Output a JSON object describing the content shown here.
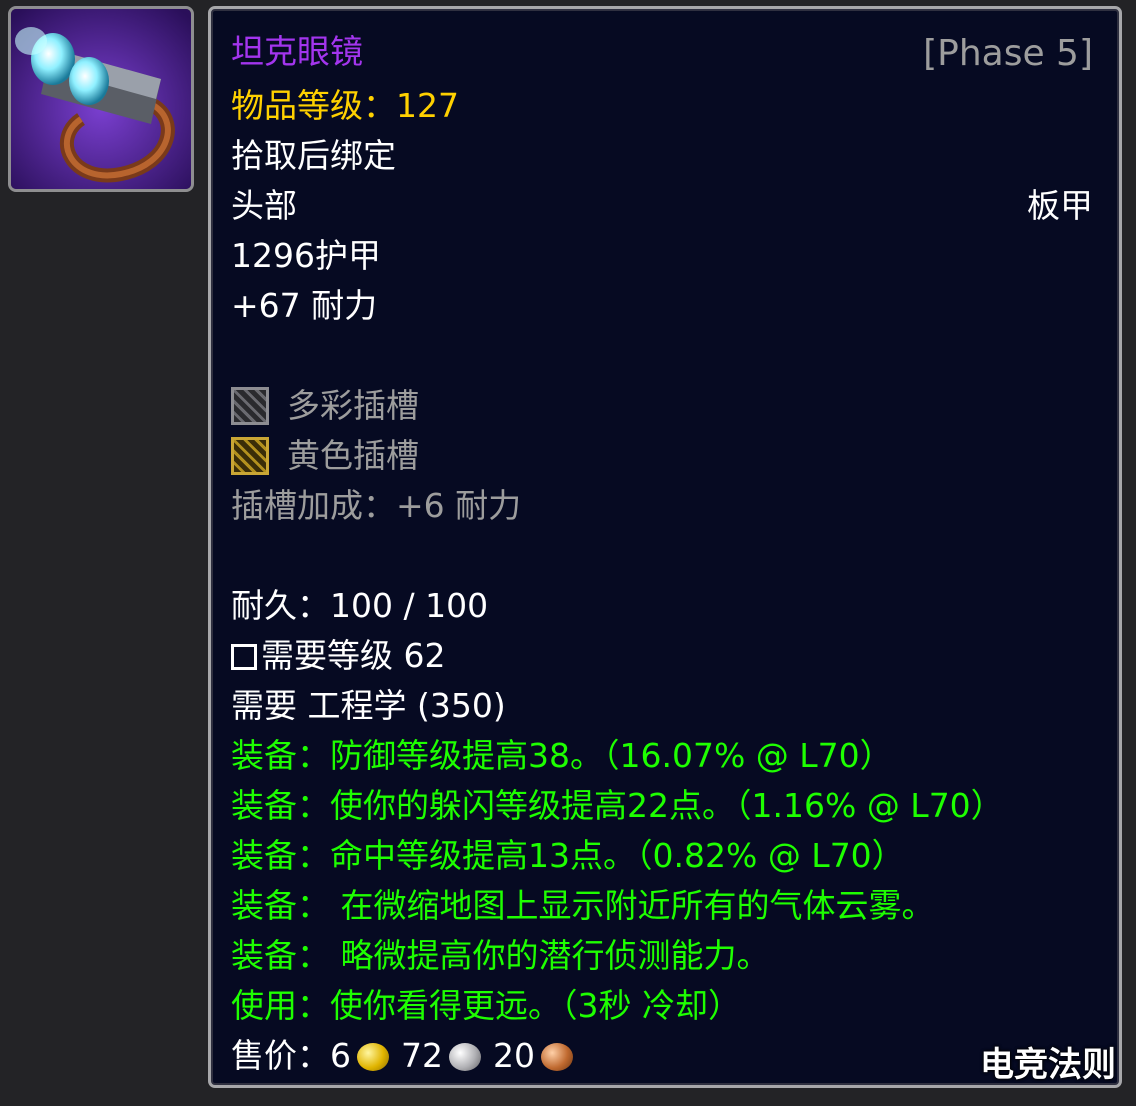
{
  "item": {
    "name": "坦克眼镜",
    "phase": "[Phase 5]",
    "item_level_label": "物品等级：",
    "item_level_value": "127",
    "binding": "拾取后绑定",
    "slot": "头部",
    "armor_type": "板甲",
    "armor": "1296护甲",
    "stamina": "+67 耐力",
    "sockets": [
      {
        "label": "多彩插槽",
        "icon": "meta-socket-icon"
      },
      {
        "label": "黄色插槽",
        "icon": "yellow-socket-icon"
      }
    ],
    "socket_bonus": "插槽加成：+6 耐力",
    "durability": "耐久：100 / 100",
    "required_level": "需要等级 62",
    "required_skill": "需要 工程学 (350)",
    "effects": [
      "装备：防御等级提高38。（16.07% @ L70）",
      "装备：使你的躲闪等级提高22点。（1.16% @ L70）",
      "装备：命中等级提高13点。（0.82% @ L70）",
      "装备：  在微缩地图上显示附近所有的气体云雾。",
      "装备：  略微提高你的潜行侦测能力。",
      "使用：使你看得更远。（3秒 冷却）"
    ],
    "sell_price": {
      "label": "售价：",
      "gold": "6",
      "silver": "72",
      "copper": "20"
    }
  },
  "watermark": "电竞法则",
  "colors": {
    "epic_purple": "#a335ee",
    "item_level_yellow": "#ffd100",
    "green_effect": "#1eff00",
    "gray_socket": "#9d9d9d",
    "tooltip_bg": "#060a22"
  }
}
